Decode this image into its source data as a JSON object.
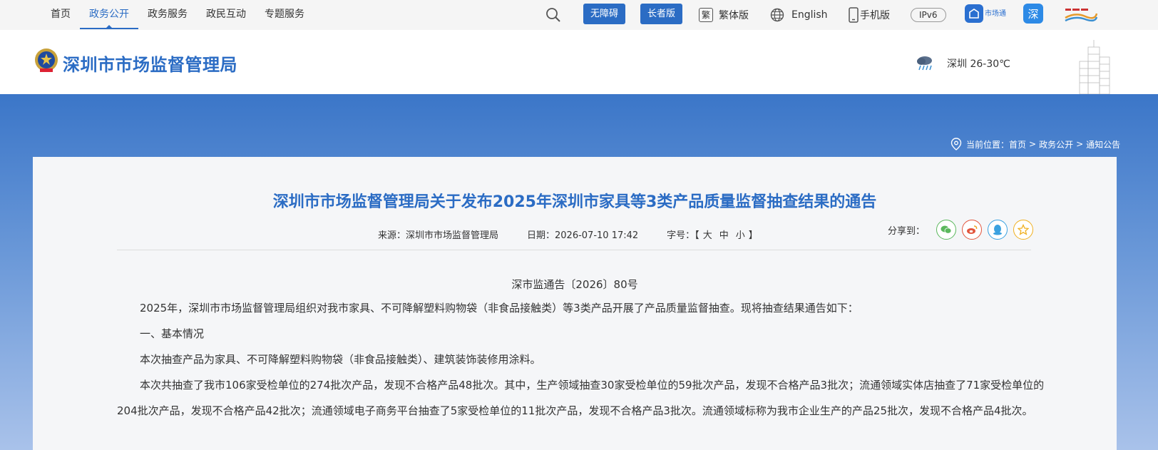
{
  "nav": {
    "items": [
      {
        "label": "首页",
        "active": false
      },
      {
        "label": "政务公开",
        "active": true
      },
      {
        "label": "政务服务",
        "active": false
      },
      {
        "label": "政民互动",
        "active": false
      },
      {
        "label": "专题服务",
        "active": false
      }
    ]
  },
  "tools": {
    "search_icon": "search-icon",
    "accessibility_label": "无障碍",
    "elderly_label": "长者版",
    "traditional_badge": "繁",
    "traditional_label": "繁体版",
    "english_label": "English",
    "mobile_label": "手机版",
    "ipv6_label": "IPv6",
    "market_app_label": "市场通",
    "app2_glyph": "深"
  },
  "header": {
    "site_title": "深圳市市场监督管理局",
    "weather_icon": "rain-cloud-icon",
    "weather_text": "深圳 26-30℃"
  },
  "breadcrumb": {
    "prefix": "当前位置：",
    "items": [
      "首页",
      "政务公开",
      "通知公告"
    ],
    "separator": ">"
  },
  "article": {
    "title": "深圳市市场监督管理局关于发布2025年深圳市家具等3类产品质量监督抽查结果的通告",
    "source_label": "来源：深圳市市场监督管理局",
    "date_label": "日期：2026-07-10 17:42",
    "fontsize_label": "字号：【",
    "fontsize_options": [
      "大",
      "中",
      "小"
    ],
    "fontsize_close": "】",
    "share_label": "分享到：",
    "share_icons": [
      "wechat-icon",
      "weibo-icon",
      "qq-icon",
      "favorite-star-icon"
    ],
    "doc_number": "深市监通告〔2026〕80号",
    "paragraphs": [
      "2025年，深圳市市场监督管理局组织对我市家具、不可降解塑料购物袋（非食品接触类）等3类产品开展了产品质量监督抽查。现将抽查结果通告如下：",
      "一、基本情况",
      "本次抽查产品为家具、不可降解塑料购物袋（非食品接触类）、建筑装饰装修用涂料。",
      "本次共抽查了我市106家受检单位的274批次产品，发现不合格产品48批次。其中，生产领域抽查30家受检单位的59批次产品，发现不合格产品3批次；流通领域实体店抽查了71家受检单位的204批次产品，发现不合格产品42批次；流通领域电子商务平台抽查了5家受检单位的11批次产品，发现不合格产品3批次。流通领域标称为我市企业生产的产品25批次，发现不合格产品4批次。"
    ]
  },
  "colors": {
    "brand_blue": "#2b6cc4",
    "topbar_bg": "#f5f5f5",
    "panel_bg": "#f5f6f8"
  }
}
